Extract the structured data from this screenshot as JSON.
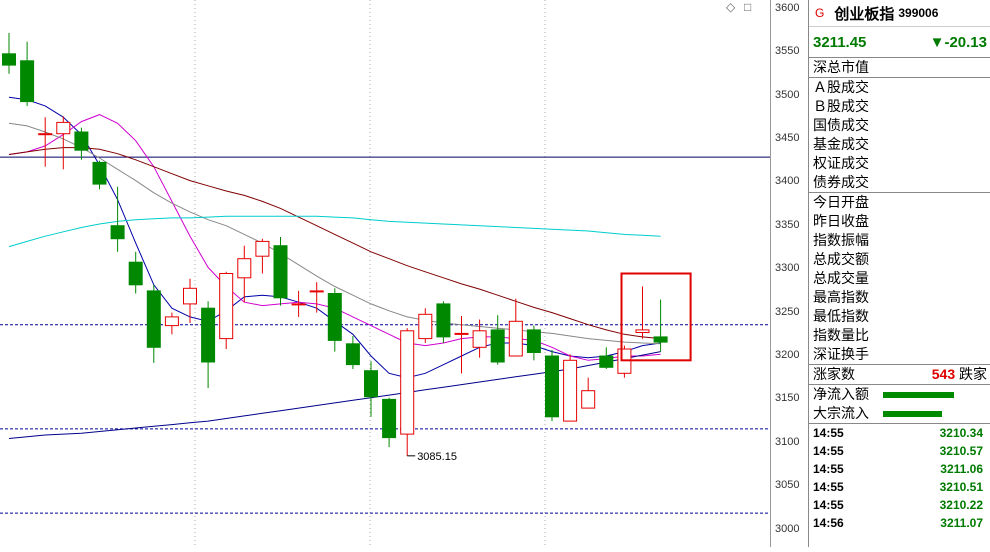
{
  "header": {
    "flag": "G",
    "name": "创业板指",
    "code": "399006"
  },
  "quote": {
    "price": "3211.45",
    "change": "▼-20.13"
  },
  "controls": [
    "◇",
    "□"
  ],
  "fields": [
    {
      "label": "深总市值",
      "sep": true
    },
    {
      "label": "Ａ股成交"
    },
    {
      "label": "Ｂ股成交"
    },
    {
      "label": "国债成交"
    },
    {
      "label": "基金成交"
    },
    {
      "label": "权证成交"
    },
    {
      "label": "债券成交",
      "sep": true
    },
    {
      "label": "今日开盘"
    },
    {
      "label": "昨日收盘"
    },
    {
      "label": "指数振幅"
    },
    {
      "label": "总成交额"
    },
    {
      "label": "总成交量"
    },
    {
      "label": "最高指数"
    },
    {
      "label": "最低指数"
    },
    {
      "label": "指数量比"
    },
    {
      "label": "深证换手",
      "sep": true
    }
  ],
  "rise_count": {
    "label": "涨家数",
    "value": "543",
    "unit": "跌家"
  },
  "flows": [
    {
      "label": "净流入额",
      "fraction": 0.75
    },
    {
      "label": "大宗流入",
      "fraction": 0.62
    }
  ],
  "ticks": [
    {
      "time": "14:55",
      "value": "3210.34"
    },
    {
      "time": "14:55",
      "value": "3210.57"
    },
    {
      "time": "14:55",
      "value": "3211.06"
    },
    {
      "time": "14:55",
      "value": "3210.51"
    },
    {
      "time": "14:55",
      "value": "3210.22"
    },
    {
      "time": "14:56",
      "value": "3211.07"
    }
  ],
  "chart_data": {
    "type": "candlestick",
    "title": "",
    "ylim": [
      2980,
      3610
    ],
    "y_ticks": [
      3000,
      3050,
      3100,
      3150,
      3200,
      3250,
      3300,
      3350,
      3400,
      3450,
      3500,
      3550,
      3600
    ],
    "candles": [
      {
        "o": 3548,
        "c": 3535,
        "h": 3572,
        "l": 3525
      },
      {
        "o": 3540,
        "c": 3493,
        "h": 3562,
        "l": 3488
      },
      {
        "o": 3456,
        "c": 3456,
        "h": 3475,
        "l": 3418
      },
      {
        "o": 3456,
        "c": 3469,
        "h": 3476,
        "l": 3415
      },
      {
        "o": 3458,
        "c": 3437,
        "h": 3463,
        "l": 3426
      },
      {
        "o": 3423,
        "c": 3398,
        "h": 3425,
        "l": 3392
      },
      {
        "o": 3350,
        "c": 3335,
        "h": 3395,
        "l": 3320
      },
      {
        "o": 3308,
        "c": 3282,
        "h": 3320,
        "l": 3272
      },
      {
        "o": 3275,
        "c": 3210,
        "h": 3282,
        "l": 3192
      },
      {
        "o": 3235,
        "c": 3245,
        "h": 3250,
        "l": 3225
      },
      {
        "o": 3260,
        "c": 3278,
        "h": 3289,
        "l": 3238
      },
      {
        "o": 3255,
        "c": 3193,
        "h": 3263,
        "l": 3163
      },
      {
        "o": 3220,
        "c": 3295,
        "h": 3297,
        "l": 3208
      },
      {
        "o": 3290,
        "c": 3312,
        "h": 3327,
        "l": 3262
      },
      {
        "o": 3315,
        "c": 3332,
        "h": 3335,
        "l": 3295
      },
      {
        "o": 3327,
        "c": 3267,
        "h": 3337,
        "l": 3258
      },
      {
        "o": 3260,
        "c": 3260,
        "h": 3275,
        "l": 3245
      },
      {
        "o": 3274,
        "c": 3275,
        "h": 3285,
        "l": 3250
      },
      {
        "o": 3272,
        "c": 3218,
        "h": 3278,
        "l": 3205
      },
      {
        "o": 3214,
        "c": 3190,
        "h": 3223,
        "l": 3185
      },
      {
        "o": 3183,
        "c": 3153,
        "h": 3194,
        "l": 3130
      },
      {
        "o": 3150,
        "c": 3106,
        "h": 3152,
        "l": 3095
      },
      {
        "o": 3110,
        "c": 3229,
        "h": 3232,
        "l": 3085
      },
      {
        "o": 3220,
        "c": 3248,
        "h": 3255,
        "l": 3215
      },
      {
        "o": 3260,
        "c": 3222,
        "h": 3263,
        "l": 3215
      },
      {
        "o": 3226,
        "c": 3226,
        "h": 3246,
        "l": 3180
      },
      {
        "o": 3210,
        "c": 3229,
        "h": 3242,
        "l": 3198
      },
      {
        "o": 3230,
        "c": 3193,
        "h": 3247,
        "l": 3190
      },
      {
        "o": 3200,
        "c": 3240,
        "h": 3266,
        "l": 3200
      },
      {
        "o": 3230,
        "c": 3204,
        "h": 3235,
        "l": 3195
      },
      {
        "o": 3200,
        "c": 3130,
        "h": 3207,
        "l": 3125
      },
      {
        "o": 3125,
        "c": 3195,
        "h": 3202,
        "l": 3125
      },
      {
        "o": 3140,
        "c": 3160,
        "h": 3175,
        "l": 3140
      },
      {
        "o": 3200,
        "c": 3187,
        "h": 3210,
        "l": 3185
      },
      {
        "o": 3180,
        "c": 3208,
        "h": 3212,
        "l": 3175
      },
      {
        "o": 3227,
        "c": 3230,
        "h": 3280,
        "l": 3220
      },
      {
        "o": 3222,
        "c": 3216,
        "h": 3265,
        "l": 3205
      }
    ],
    "ma": [
      {
        "name": "",
        "color": "#0000a8",
        "values": [
          3498,
          3495,
          3488,
          3475,
          3455,
          3420,
          3380,
          3330,
          3282,
          3255,
          3245,
          3240,
          3252,
          3268,
          3270,
          3268,
          3262,
          3255,
          3240,
          3225,
          3200,
          3180,
          3175,
          3180,
          3190,
          3200,
          3210,
          3215,
          3215,
          3212,
          3205,
          3200,
          3198,
          3200,
          3205,
          3212,
          3215
        ]
      },
      {
        "name": "",
        "color": "#d000d0",
        "values": [
          3432,
          3435,
          3442,
          3455,
          3470,
          3478,
          3468,
          3448,
          3418,
          3378,
          3338,
          3302,
          3280,
          3262,
          3258,
          3260,
          3262,
          3260,
          3255,
          3245,
          3235,
          3225,
          3215,
          3212,
          3215,
          3220,
          3222,
          3222,
          3220,
          3218,
          3210,
          3200,
          3195,
          3197,
          3200,
          3200,
          3202
        ]
      },
      {
        "name": "",
        "color": "#888888",
        "values": [
          3468,
          3465,
          3458,
          3450,
          3440,
          3428,
          3415,
          3402,
          3388,
          3376,
          3366,
          3357,
          3350,
          3340,
          3330,
          3318,
          3305,
          3292,
          3280,
          3270,
          3260,
          3252,
          3245,
          3241,
          3238,
          3236,
          3234,
          3232,
          3230,
          3228,
          3226,
          3223,
          3220,
          3218,
          3216,
          3215,
          3214
        ]
      },
      {
        "name": "",
        "color": "#800000",
        "values": [
          3432,
          3435,
          3438,
          3440,
          3440,
          3438,
          3433,
          3426,
          3418,
          3410,
          3402,
          3396,
          3390,
          3385,
          3378,
          3370,
          3360,
          3350,
          3340,
          3330,
          3320,
          3312,
          3304,
          3297,
          3290,
          3283,
          3277,
          3270,
          3263,
          3256,
          3250,
          3243,
          3236,
          3230,
          3225,
          3222,
          3220
        ]
      },
      {
        "name": "",
        "color": "#00cccc",
        "values": [
          3326,
          3332,
          3338,
          3343,
          3348,
          3352,
          3355,
          3357,
          3358,
          3359,
          3359,
          3360,
          3361,
          3361,
          3361,
          3361,
          3361,
          3361,
          3360,
          3359,
          3357,
          3355,
          3354,
          3353,
          3352,
          3351,
          3350,
          3349,
          3348,
          3347,
          3346,
          3345,
          3344,
          3342,
          3340,
          3339,
          3338
        ]
      },
      {
        "name": "",
        "color": "#00008b",
        "values": [
          3105,
          3107,
          3109,
          3110,
          3111,
          3113,
          3115,
          3117,
          3119,
          3121,
          3123,
          3125,
          3128,
          3131,
          3134,
          3137,
          3140,
          3143,
          3146,
          3149,
          3152,
          3155,
          3158,
          3161,
          3164,
          3167,
          3170,
          3173,
          3176,
          3179,
          3182,
          3185,
          3189,
          3193,
          3197,
          3201,
          3205
        ]
      }
    ],
    "hlines": [
      {
        "value": 3429,
        "color": "#000066",
        "style": "solid"
      },
      {
        "value": 3236,
        "color": "#000099",
        "style": "dash"
      },
      {
        "value": 3116,
        "color": "#000099",
        "style": "dash"
      },
      {
        "value": 3019,
        "color": "#000099",
        "style": "dash"
      }
    ],
    "low_annotation": {
      "index": 22,
      "value": 3085,
      "label": "3085.15"
    },
    "highlight_box": {
      "from": 35,
      "to": 36,
      "y_top": 3295,
      "y_bottom": 3195,
      "color": "#e00000"
    }
  }
}
